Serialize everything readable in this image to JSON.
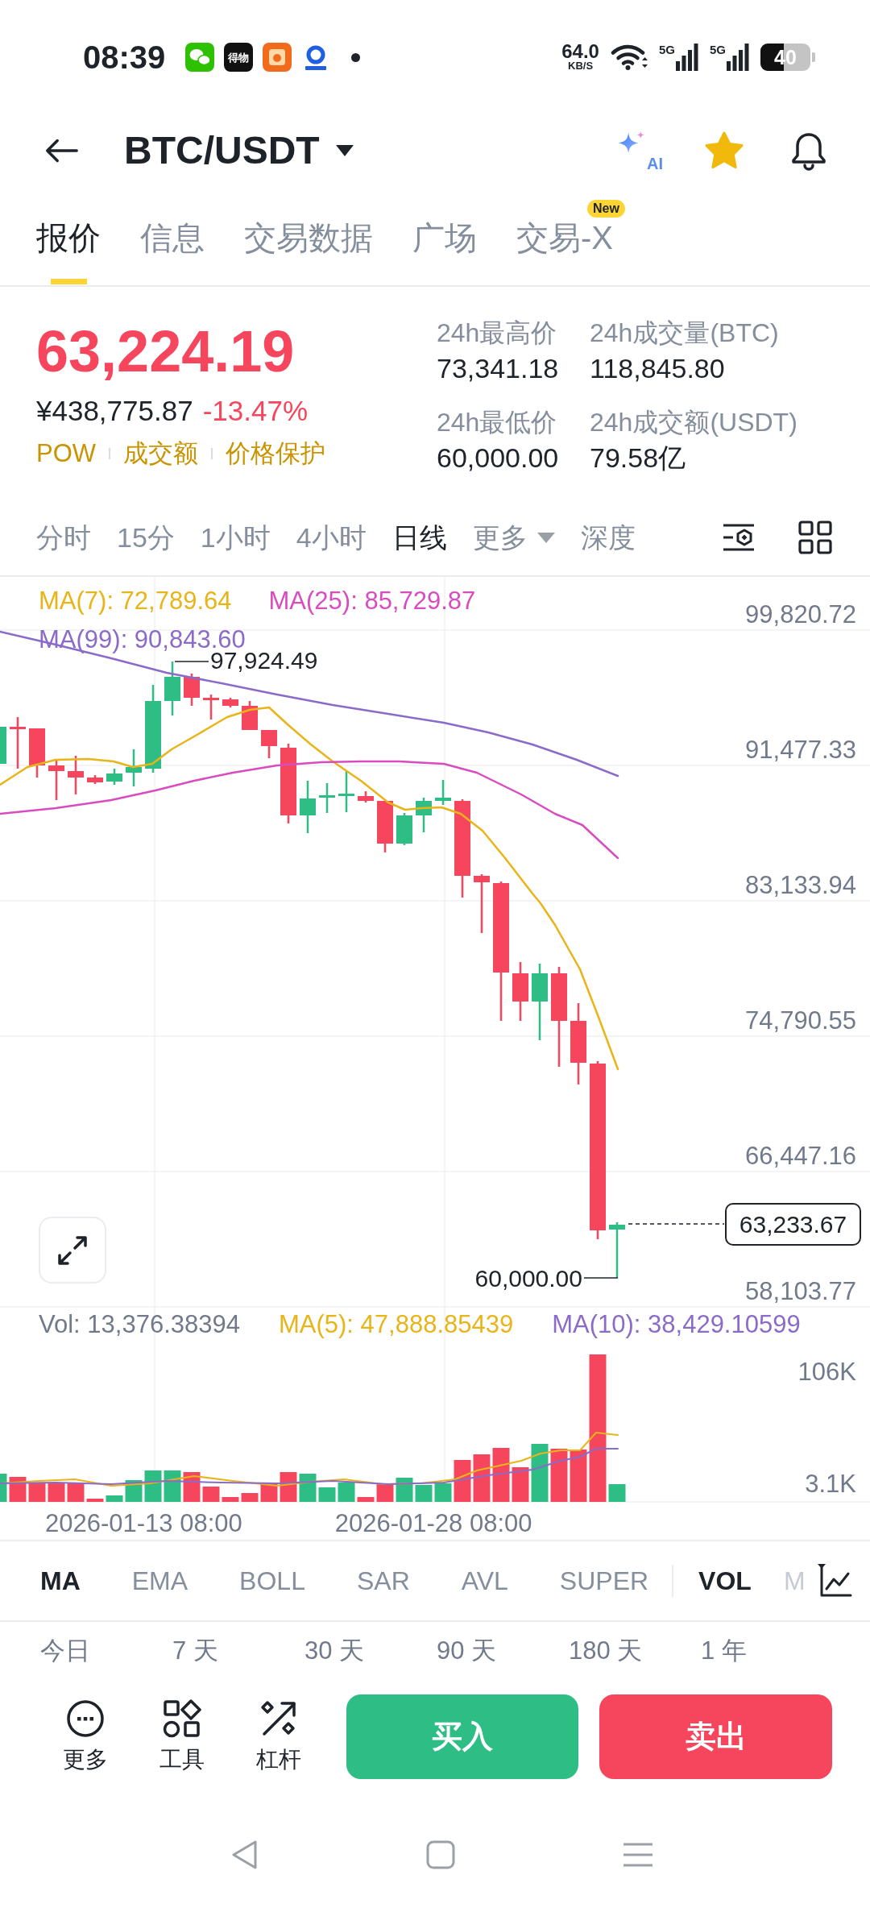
{
  "status_bar": {
    "time": "08:39",
    "app_icon_text": "得物",
    "network_speed": "64.0",
    "network_speed_unit": "KB/S",
    "signals": [
      {
        "label": "5G"
      },
      {
        "label": "5G"
      }
    ],
    "battery": "40"
  },
  "header": {
    "title": "BTC/USDT",
    "ai_label": "AI",
    "favorite": true
  },
  "tabs": [
    {
      "label": "报价",
      "selected": true
    },
    {
      "label": "信息",
      "selected": false
    },
    {
      "label": "交易数据",
      "selected": false
    },
    {
      "label": "广场",
      "selected": false
    },
    {
      "label": "交易-X",
      "selected": false,
      "badge": "New"
    }
  ],
  "ticker": {
    "last_price": "63,224.19",
    "fiat_price": "¥438,775.87",
    "change": "-13.47%",
    "tags": [
      "POW",
      "成交额",
      "价格保护"
    ],
    "stats": [
      {
        "label": "24h最高价",
        "value": "73,341.18"
      },
      {
        "label": "24h成交量(BTC)",
        "value": "118,845.80"
      },
      {
        "label": "24h最低价",
        "value": "60,000.00"
      },
      {
        "label": "24h成交额(USDT)",
        "value": "79.58亿"
      }
    ]
  },
  "intervals": [
    {
      "label": "分时",
      "kind": "interval",
      "selected": false
    },
    {
      "label": "15分",
      "kind": "interval",
      "selected": false
    },
    {
      "label": "1小时",
      "kind": "interval",
      "selected": false
    },
    {
      "label": "4小时",
      "kind": "interval",
      "selected": false
    },
    {
      "label": "日线",
      "kind": "interval",
      "selected": true
    },
    {
      "label": "更多",
      "kind": "dropdown",
      "selected": false
    },
    {
      "label": "深度",
      "kind": "interval",
      "selected": false
    }
  ],
  "chart": {
    "legend": [
      {
        "label": "MA(7): 72,789.64",
        "color": "#e9b418"
      },
      {
        "label": "MA(25): 85,729.87",
        "color": "#d94cc0"
      },
      {
        "label": "MA(99): 90,843.60",
        "color": "#8a6bc9"
      }
    ],
    "y_axis": [
      "99,820.72",
      "91,477.33",
      "83,133.94",
      "74,790.55",
      "66,447.16",
      "58,103.77"
    ],
    "high_label": "97,924.49",
    "low_label": "60,000.00",
    "current_price": "63,233.67"
  },
  "volume": {
    "legend": [
      {
        "label": "Vol: 13,376.38394",
        "color": "#707a8a"
      },
      {
        "label": "MA(5): 47,888.85439",
        "color": "#e9b418"
      },
      {
        "label": "MA(10): 38,429.10599",
        "color": "#8a6bc9"
      }
    ],
    "y_axis": [
      "106K",
      "3.1K"
    ]
  },
  "x_axis": [
    "2026-01-13 08:00",
    "2026-01-28 08:00"
  ],
  "main_indicators": [
    {
      "label": "MA",
      "selected": true
    },
    {
      "label": "EMA",
      "selected": false
    },
    {
      "label": "BOLL",
      "selected": false
    },
    {
      "label": "SAR",
      "selected": false
    },
    {
      "label": "AVL",
      "selected": false
    },
    {
      "label": "SUPER",
      "selected": false
    }
  ],
  "sub_indicators": [
    {
      "label": "VOL",
      "selected": true
    },
    {
      "label": "M",
      "selected": false
    }
  ],
  "periods": [
    "今日",
    "7 天",
    "30 天",
    "90 天",
    "180 天",
    "1 年"
  ],
  "toolbar": [
    {
      "label": "更多",
      "kind": "more"
    },
    {
      "label": "工具",
      "kind": "tools"
    },
    {
      "label": "杠杆",
      "kind": "leverage"
    }
  ],
  "actions": [
    {
      "label": "买入",
      "kind": "buy"
    },
    {
      "label": "卖出",
      "kind": "sell"
    }
  ]
}
